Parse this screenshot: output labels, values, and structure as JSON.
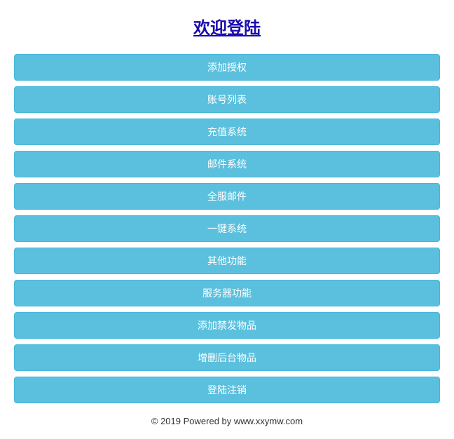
{
  "title": "欢迎登陆",
  "menu": {
    "items": [
      "添加授权",
      "账号列表",
      "充值系统",
      "邮件系统",
      "全服邮件",
      "一键系统",
      "其他功能",
      "服务器功能",
      "添加禁发物品",
      "增删后台物品",
      "登陆注销"
    ]
  },
  "footer": "© 2019 Powered by www.xxymw.com"
}
